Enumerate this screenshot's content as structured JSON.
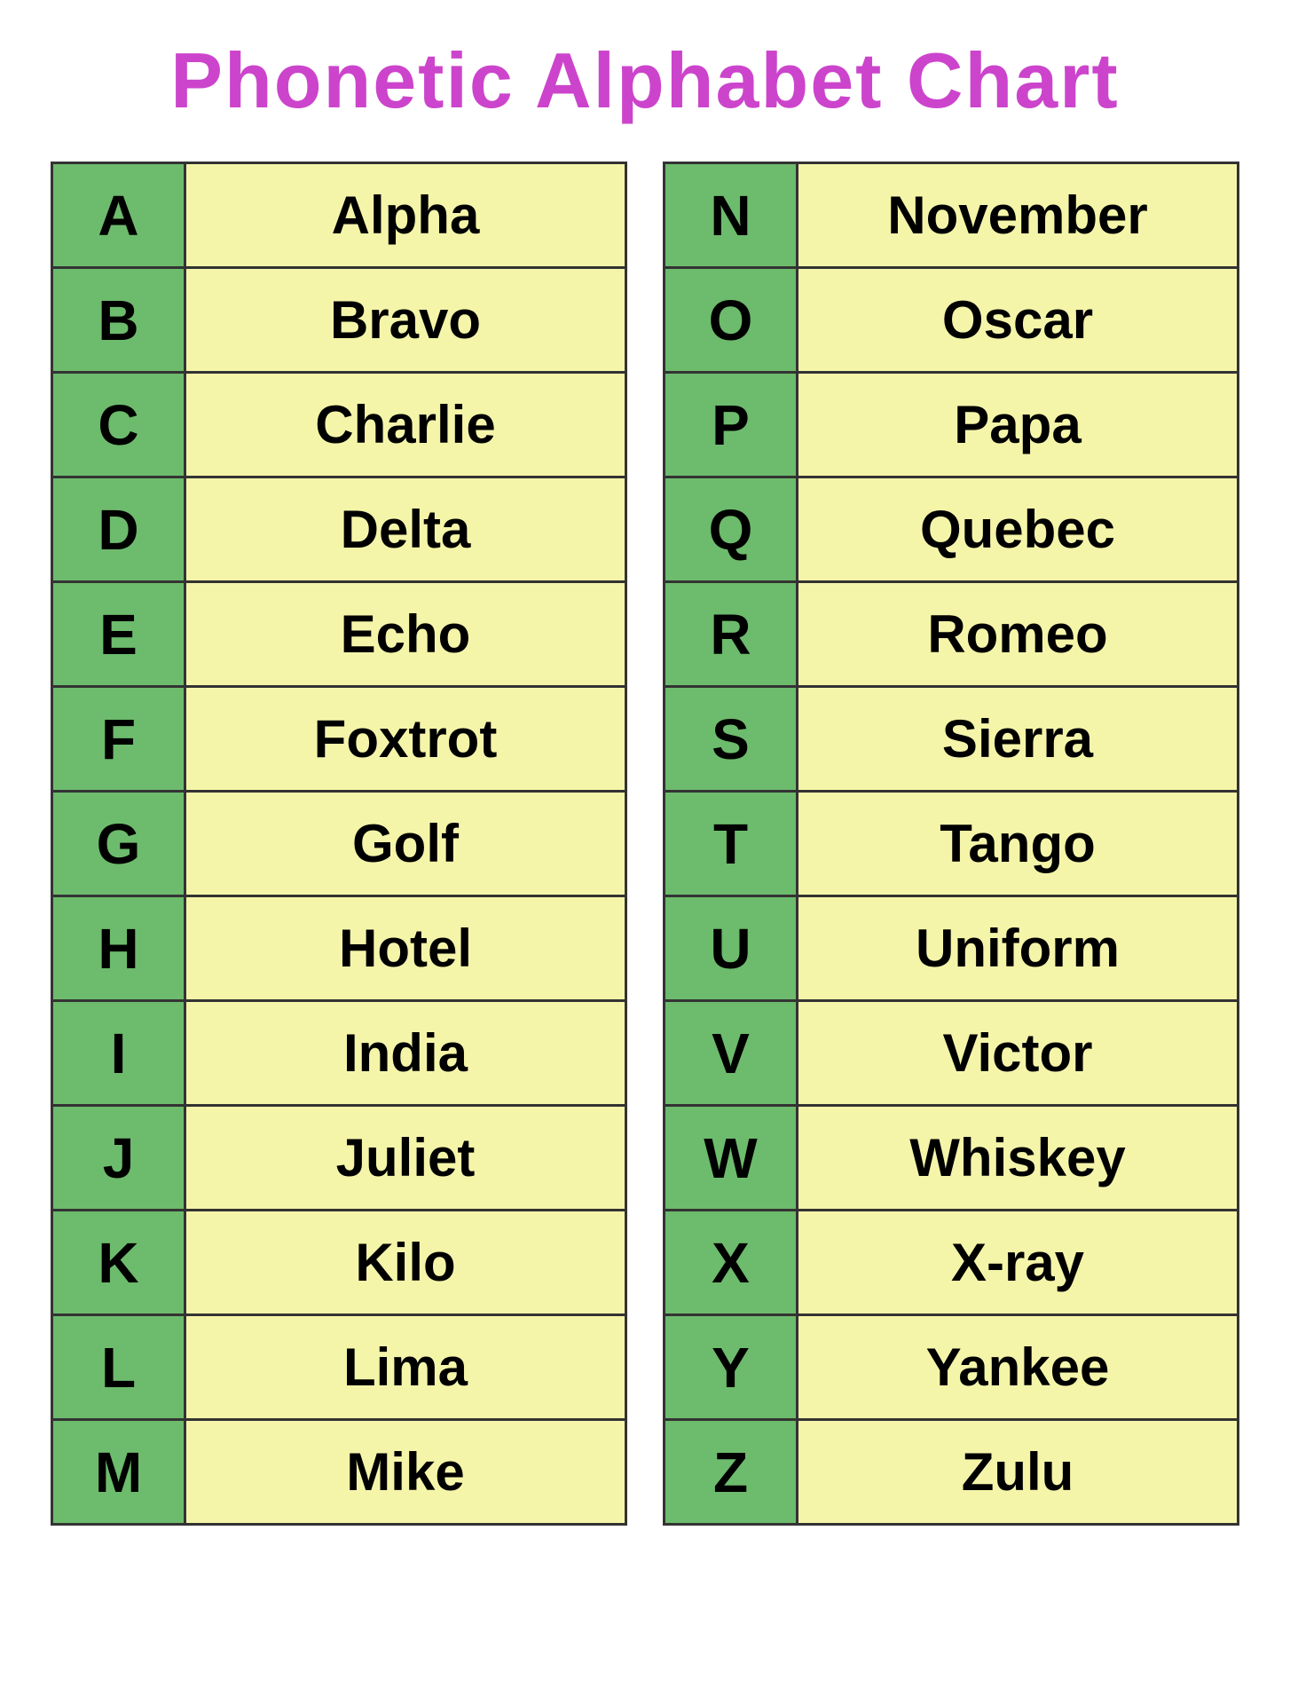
{
  "title": "Phonetic Alphabet Chart",
  "left_table": [
    {
      "letter": "A",
      "word": "Alpha"
    },
    {
      "letter": "B",
      "word": "Bravo"
    },
    {
      "letter": "C",
      "word": "Charlie"
    },
    {
      "letter": "D",
      "word": "Delta"
    },
    {
      "letter": "E",
      "word": "Echo"
    },
    {
      "letter": "F",
      "word": "Foxtrot"
    },
    {
      "letter": "G",
      "word": "Golf"
    },
    {
      "letter": "H",
      "word": "Hotel"
    },
    {
      "letter": "I",
      "word": "India"
    },
    {
      "letter": "J",
      "word": "Juliet"
    },
    {
      "letter": "K",
      "word": "Kilo"
    },
    {
      "letter": "L",
      "word": "Lima"
    },
    {
      "letter": "M",
      "word": "Mike"
    }
  ],
  "right_table": [
    {
      "letter": "N",
      "word": "November"
    },
    {
      "letter": "O",
      "word": "Oscar"
    },
    {
      "letter": "P",
      "word": "Papa"
    },
    {
      "letter": "Q",
      "word": "Quebec"
    },
    {
      "letter": "R",
      "word": "Romeo"
    },
    {
      "letter": "S",
      "word": "Sierra"
    },
    {
      "letter": "T",
      "word": "Tango"
    },
    {
      "letter": "U",
      "word": "Uniform"
    },
    {
      "letter": "V",
      "word": "Victor"
    },
    {
      "letter": "W",
      "word": "Whiskey"
    },
    {
      "letter": "X",
      "word": "X-ray"
    },
    {
      "letter": "Y",
      "word": "Yankee"
    },
    {
      "letter": "Z",
      "word": "Zulu"
    }
  ]
}
